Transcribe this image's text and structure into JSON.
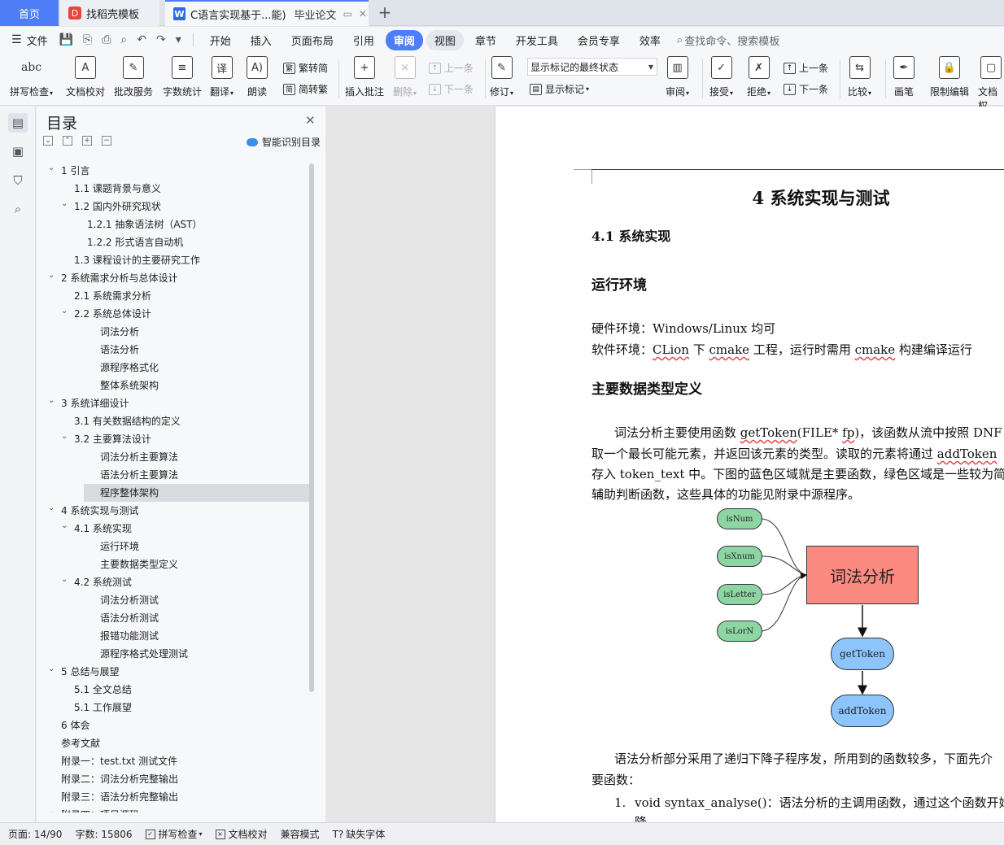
{
  "tabs": {
    "home": "首页",
    "daoke": "找稻壳模板",
    "doc_title": "C语言实现基于...能)",
    "doc_sub": "毕业论文"
  },
  "menu": {
    "file": "文件",
    "items": [
      "开始",
      "插入",
      "页面布局",
      "引用",
      "审阅",
      "视图",
      "章节",
      "开发工具",
      "会员专享",
      "效率"
    ],
    "search_placeholder": "查找命令、搜索模板"
  },
  "ribbon": {
    "spell": "拼写检查",
    "proofread": "文档校对",
    "annotate_service": "批改服务",
    "wordcount": "字数统计",
    "translate": "翻译",
    "read_aloud": "朗读",
    "to_traditional": "繁转简",
    "to_simplified": "简转繁",
    "insert_comment": "插入批注",
    "delete": "删除",
    "prev": "上一条",
    "next": "下一条",
    "track": "修订",
    "mark_state": "显示标记的最终状态",
    "show_marks": "显示标记",
    "review": "审阅",
    "accept": "接受",
    "reject": "拒绝",
    "prev2": "上一条",
    "next2": "下一条",
    "compare": "比较",
    "pen": "画笔",
    "restrict": "限制编辑",
    "doc_perm": "文档权"
  },
  "toc": {
    "title": "目录",
    "smart": "智能识别目录",
    "items": [
      {
        "label": "1 引言",
        "level": 0,
        "toggle": true
      },
      {
        "label": "1.1 课题背景与意义",
        "level": 1,
        "toggle": false
      },
      {
        "label": "1.2 国内外研究现状",
        "level": 1,
        "toggle": true
      },
      {
        "label": "1.2.1  抽象语法树（AST）",
        "level": 2,
        "toggle": false
      },
      {
        "label": "1.2.2  形式语言自动机",
        "level": 2,
        "toggle": false
      },
      {
        "label": "1.3 课程设计的主要研究工作",
        "level": 1,
        "toggle": false
      },
      {
        "label": "2 系统需求分析与总体设计",
        "level": 0,
        "toggle": true
      },
      {
        "label": "2.1 系统需求分析",
        "level": 1,
        "toggle": false
      },
      {
        "label": "2.2 系统总体设计",
        "level": 1,
        "toggle": true
      },
      {
        "label": "词法分析",
        "level": 3,
        "toggle": false
      },
      {
        "label": "语法分析",
        "level": 3,
        "toggle": false
      },
      {
        "label": "源程序格式化",
        "level": 3,
        "toggle": false
      },
      {
        "label": "整体系统架构",
        "level": 3,
        "toggle": false
      },
      {
        "label": "3 系统详细设计",
        "level": 0,
        "toggle": true
      },
      {
        "label": "3.1 有关数据结构的定义",
        "level": 1,
        "toggle": false
      },
      {
        "label": "3.2  主要算法设计",
        "level": 1,
        "toggle": true
      },
      {
        "label": "词法分析主要算法",
        "level": 3,
        "toggle": false
      },
      {
        "label": "语法分析主要算法",
        "level": 3,
        "toggle": false
      },
      {
        "label": "程序整体架构",
        "level": 3,
        "toggle": false,
        "selected": true
      },
      {
        "label": "4 系统实现与测试",
        "level": 0,
        "toggle": true
      },
      {
        "label": "4.1 系统实现",
        "level": 1,
        "toggle": true
      },
      {
        "label": "运行环境",
        "level": 3,
        "toggle": false
      },
      {
        "label": "主要数据类型定义",
        "level": 3,
        "toggle": false
      },
      {
        "label": "4.2 系统测试",
        "level": 1,
        "toggle": true
      },
      {
        "label": "词法分析测试",
        "level": 3,
        "toggle": false
      },
      {
        "label": "语法分析测试",
        "level": 3,
        "toggle": false
      },
      {
        "label": "报错功能测试",
        "level": 3,
        "toggle": false
      },
      {
        "label": "源程序格式处理测试",
        "level": 3,
        "toggle": false
      },
      {
        "label": "5 总结与展望",
        "level": 0,
        "toggle": true
      },
      {
        "label": "5.1 全文总结",
        "level": 1,
        "toggle": false
      },
      {
        "label": "5.1 工作展望",
        "level": 1,
        "toggle": false
      },
      {
        "label": "6   体会",
        "level": 0,
        "toggle": false
      },
      {
        "label": "参考文献",
        "level": 0,
        "toggle": false
      },
      {
        "label": "附录一：test.txt 测试文件",
        "level": 0,
        "toggle": false
      },
      {
        "label": "附录二：词法分析完整输出",
        "level": 0,
        "toggle": false
      },
      {
        "label": "附录三：语法分析完整输出",
        "level": 0,
        "toggle": false
      },
      {
        "label": "附录四：项目源码",
        "level": 0,
        "toggle": true
      }
    ]
  },
  "document": {
    "chapter": "4 系统实现与测试",
    "section": "4.1 系统实现",
    "sub_env": "运行环境",
    "hw_label": "硬件环境：",
    "hw_value": "Windows/Linux 均可",
    "sw_label": "软件环境：",
    "sw_clion": "CLion",
    "sw_mid1": " 下 ",
    "sw_cmake1": "cmake",
    "sw_mid2": " 工程，运行时需用 ",
    "sw_cmake2": "cmake",
    "sw_end": " 构建编译运行",
    "sub_types": "主要数据类型定义",
    "p1_l1_a": "词法分析主要使用函数 ",
    "p1_l1_fn": "getToken",
    "p1_l1_b": "(FILE* ",
    "p1_l1_fp": "fp",
    "p1_l1_c": ")，该函数从流中按照 DNF 规",
    "p1_l2_a": "取一个最长可能元素，并返回该元素的类型。读取的元素将通过 ",
    "p1_l2_fn": "addToken",
    "p1_l3": "存入 token_text 中。下图的蓝色区域就是主要函数，绿色区域是一些较为简",
    "p1_l4": "辅助判断函数，这些具体的功能见附录中源程序。",
    "diagram": {
      "green_nodes": [
        "isNum",
        "isXnum",
        "isLetter",
        "isLorN"
      ],
      "center": "词法分析",
      "blue_nodes": [
        "getToken",
        "addToken"
      ]
    },
    "p2_l1": "语法分析部分采用了递归下降子程序发，所用到的函数较多，下面先介",
    "p2_l2": "要函数：",
    "li1_num": "1.",
    "li1_text": "void syntax_analyse()：语法分析的主调用函数，通过这个函数开始语",
    "li1_cont": "降"
  },
  "status": {
    "page": "页面: 14/90",
    "words": "字数: 15806",
    "spell": "拼写检查",
    "proof": "文档校对",
    "compat": "兼容模式",
    "missing_font": "缺失字体"
  }
}
